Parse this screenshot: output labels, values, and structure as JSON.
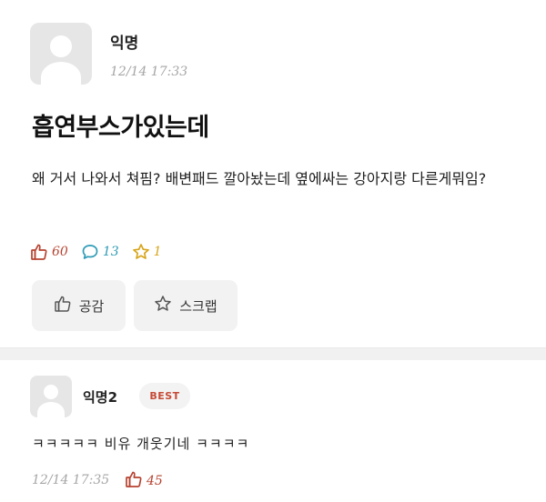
{
  "post": {
    "author": "익명",
    "timestamp": "12/14 17:33",
    "title": "흡연부스가있는데",
    "body": "왜 거서 나와서 쳐핌? 배변패드 깔아놨는데 옆에싸는 강아지랑 다른게뭐임?",
    "stats": {
      "likes": "60",
      "comments": "13",
      "scraps": "1"
    },
    "actions": {
      "empathy_label": "공감",
      "scrap_label": "스크랩"
    }
  },
  "comment": {
    "author": "익명2",
    "badge": "BEST",
    "text": "ㅋㅋㅋㅋㅋ 비유 개웃기네 ㅋㅋㅋㅋ",
    "timestamp": "12/14 17:35",
    "likes": "45"
  },
  "colors": {
    "like": "#b64230",
    "comment": "#2f9bb5",
    "scrap": "#d8a51b",
    "badge_text": "#c64a36"
  },
  "icons": [
    "thumbs-up-icon",
    "speech-bubble-icon",
    "star-icon"
  ]
}
